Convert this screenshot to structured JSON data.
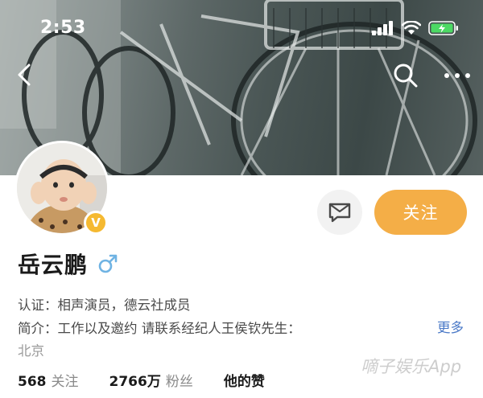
{
  "status_bar": {
    "time": "2:53"
  },
  "profile": {
    "name": "岳云鹏",
    "verified_mark": "V",
    "certification": "认证：相声演员，德云社成员",
    "bio": "简介：工作以及邀约 请联系经纪人王侯钦先生：",
    "more_label": "更多",
    "location": "北京"
  },
  "actions": {
    "follow_label": "关注"
  },
  "stats": {
    "following_count": "568",
    "following_label": "关注",
    "followers_count": "2766万",
    "followers_label": "粉丝",
    "likes_label": "他的赞"
  },
  "watermark": "嘀子娱乐App",
  "icons": [
    "back-icon",
    "search-icon",
    "more-icon",
    "signal-icon",
    "wifi-icon",
    "battery-icon",
    "message-icon",
    "male-icon",
    "verified-badge"
  ],
  "colors": {
    "follow_button": "#f4ae47",
    "verified_badge": "#f5b931",
    "more_link": "#4a79c7",
    "male_icon": "#6fb3e3",
    "battery": "#4cd964"
  }
}
